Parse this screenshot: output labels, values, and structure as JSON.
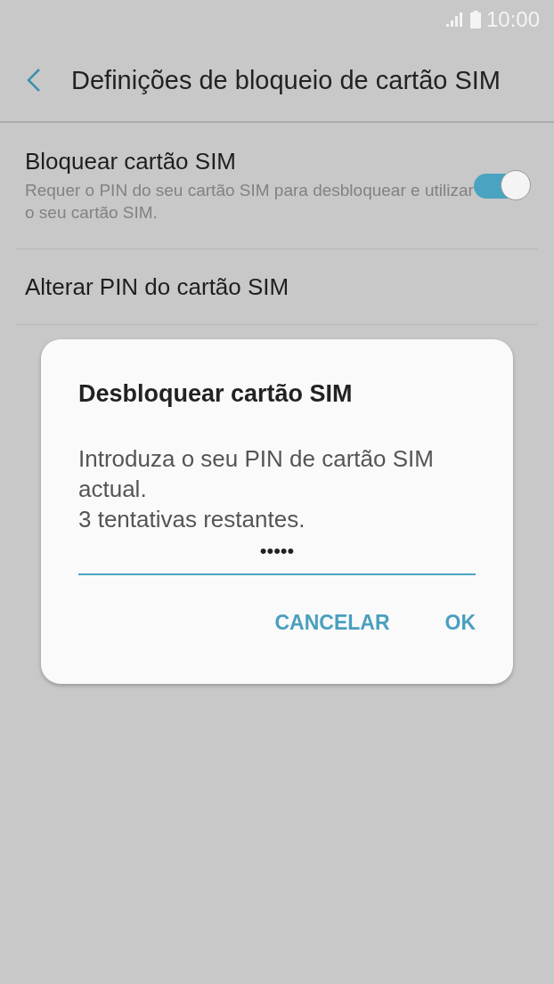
{
  "status_bar": {
    "time": "10:00"
  },
  "header": {
    "title": "Definições de bloqueio de cartão SIM"
  },
  "settings": [
    {
      "kind": "toggle",
      "title": "Bloquear cartão SIM",
      "subtitle": "Requer o PIN do seu cartão SIM para desbloquear e utilizar o seu cartão SIM.",
      "on": true
    },
    {
      "kind": "plain",
      "title": "Alterar PIN do cartão SIM"
    }
  ],
  "dialog": {
    "title": "Desbloquear cartão SIM",
    "message": "Introduza o seu PIN de cartão SIM actual.\n3 tentativas restantes.",
    "pin_field": {
      "value": "•••••"
    },
    "buttons": [
      "CANCELAR",
      "OK"
    ]
  }
}
